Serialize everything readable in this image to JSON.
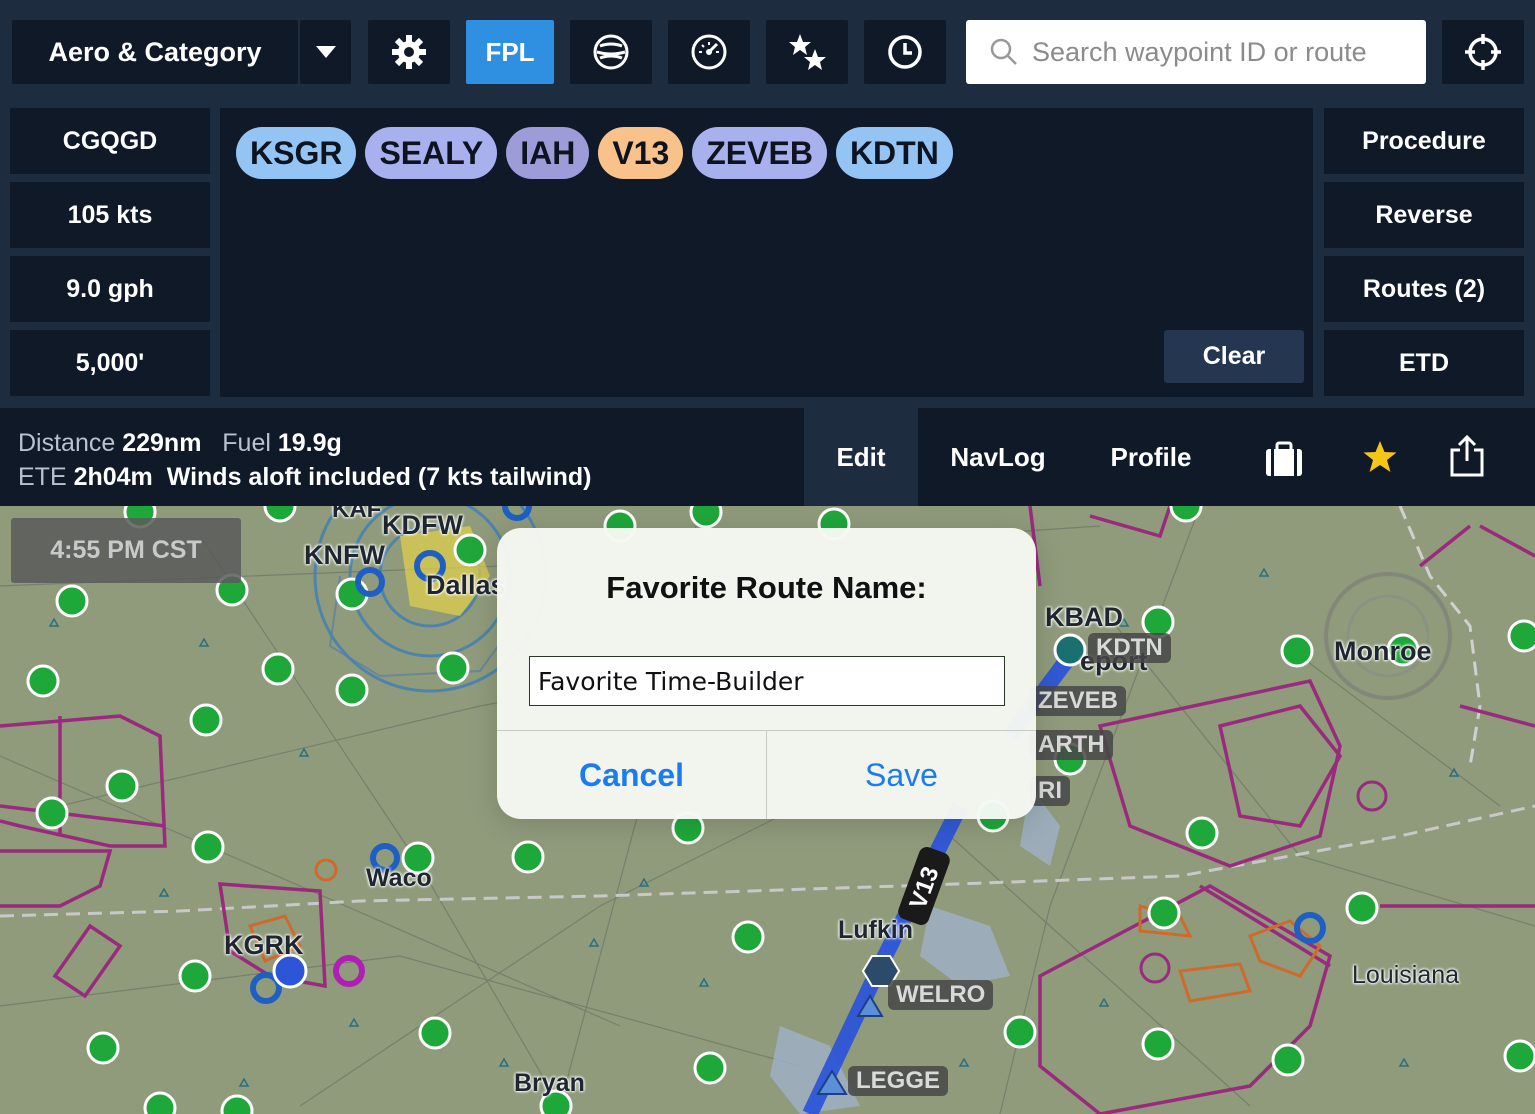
{
  "toolbar": {
    "layer_label": "Aero & Category",
    "fpl_label": "FPL",
    "search_placeholder": "Search waypoint ID or route",
    "icons": [
      "chevron-down-icon",
      "gear-icon",
      "weather-imagery-icon",
      "gauge-icon",
      "stars-icon",
      "clock-icon",
      "search-icon",
      "locate-icon"
    ]
  },
  "aircraft": {
    "tail": "CGQGD",
    "speed": "105 kts",
    "fuel_burn": "9.0 gph",
    "altitude": "5,000'"
  },
  "route": {
    "waypoints": [
      {
        "id": "KSGR",
        "color": "#93c4f4"
      },
      {
        "id": "SEALY",
        "color": "#a8b1ee"
      },
      {
        "id": "IAH",
        "color": "#9d9cd9"
      },
      {
        "id": "V13",
        "color": "#f8c28a"
      },
      {
        "id": "ZEVEB",
        "color": "#a8b1ee"
      },
      {
        "id": "KDTN",
        "color": "#93c4f4"
      }
    ],
    "clear_label": "Clear"
  },
  "actions": {
    "procedure": "Procedure",
    "reverse": "Reverse",
    "routes": "Routes (2)",
    "etd": "ETD"
  },
  "summary": {
    "distance_label": "Distance",
    "distance_value": "229nm",
    "fuel_label": "Fuel",
    "fuel_value": "19.9g",
    "ete_label": "ETE",
    "ete_value": "2h04m",
    "winds_note": "Winds aloft included (7 kts tailwind)"
  },
  "tabs": {
    "edit": "Edit",
    "navlog": "NavLog",
    "profile": "Profile",
    "icons": [
      "briefcase-icon",
      "star-icon",
      "share-icon"
    ]
  },
  "map": {
    "time": "4:55 PM CST",
    "labels": {
      "kdfw": "KDFW",
      "knfw": "KNFW",
      "kaf": "KAF",
      "dallas": "Dallas",
      "kbad": "KBAD",
      "shreveport": "eport",
      "monroe": "Monroe",
      "waco": "Waco",
      "kgrk": "KGRK",
      "lufkin": "Lufkin",
      "louisiana": "Louisiana",
      "bryan": "Bryan",
      "route_airway": "V13"
    },
    "tags": {
      "kdtn": "KDTN",
      "zeveb": "ZEVEB",
      "arth": "ARTH",
      "ri": "RI",
      "welro": "WELRO",
      "legge": "LEGGE"
    },
    "colors": {
      "route": "#2d55d8",
      "airspace": "#9a2a7e",
      "airport_green": "#1fa83a",
      "towered_blue": "#1f5fc4"
    }
  },
  "dialog": {
    "title": "Favorite Route Name:",
    "input_value": "Favorite Time-Builder",
    "cancel": "Cancel",
    "save": "Save"
  }
}
